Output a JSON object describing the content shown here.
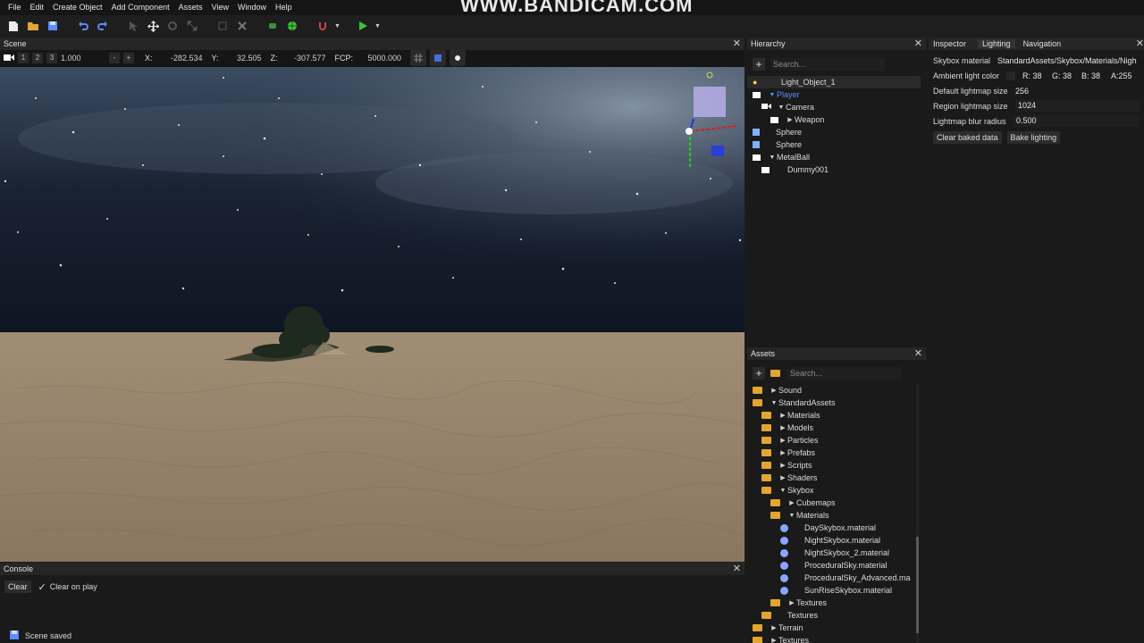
{
  "watermark": "WWW.BANDICAM.COM",
  "menubar": {
    "items": [
      "File",
      "Edit",
      "Create Object",
      "Add Component",
      "Assets",
      "View",
      "Window",
      "Help"
    ]
  },
  "scene": {
    "title": "Scene",
    "layers": [
      "1",
      "2",
      "3"
    ],
    "zoom": "1.000",
    "minus": "-",
    "plus": "+",
    "x_label": "X:",
    "x": "-282.534",
    "y_label": "Y:",
    "y": "32.505",
    "z_label": "Z:",
    "z": "-307.577",
    "fcp_label": "FCP:",
    "fcp": "5000.000"
  },
  "console": {
    "title": "Console",
    "clear": "Clear",
    "clear_on_play": "Clear on play",
    "status": "Scene saved"
  },
  "hierarchy": {
    "title": "Hierarchy",
    "search_placeholder": "Search...",
    "items": [
      {
        "label": "Light_Object_1"
      },
      {
        "label": "Player"
      },
      {
        "label": "Camera"
      },
      {
        "label": "Weapon"
      },
      {
        "label": "Sphere"
      },
      {
        "label": "Sphere"
      },
      {
        "label": "MetalBall"
      },
      {
        "label": "Dummy001"
      }
    ]
  },
  "assets": {
    "title": "Assets",
    "search_placeholder": "Search...",
    "items": [
      {
        "label": "Sound"
      },
      {
        "label": "StandardAssets"
      },
      {
        "label": "Materials"
      },
      {
        "label": "Models"
      },
      {
        "label": "Particles"
      },
      {
        "label": "Prefabs"
      },
      {
        "label": "Scripts"
      },
      {
        "label": "Shaders"
      },
      {
        "label": "Skybox"
      },
      {
        "label": "Cubemaps"
      },
      {
        "label": "Materials"
      },
      {
        "label": "DaySkybox.material"
      },
      {
        "label": "NightSkybox.material"
      },
      {
        "label": "NightSkybox_2.material"
      },
      {
        "label": "ProceduralSky.material"
      },
      {
        "label": "ProceduralSky_Advanced.ma"
      },
      {
        "label": "SunRiseSkybox.material"
      },
      {
        "label": "Textures"
      },
      {
        "label": "Textures"
      },
      {
        "label": "Terrain"
      },
      {
        "label": "Textures"
      }
    ]
  },
  "inspector": {
    "tabs": [
      "Inspector",
      "Lighting",
      "Navigation"
    ],
    "skybox_label": "Skybox material",
    "skybox_value": "StandardAssets/Skybox/Materials/Nigh",
    "ambient_label": "Ambient light color",
    "ambient_r": "R: 38",
    "ambient_g": "G: 38",
    "ambient_b": "B: 38",
    "ambient_a": "A:255",
    "lightmap_label": "Default lightmap size",
    "lightmap_value": "256",
    "region_label": "Region lightmap size",
    "region_value": "1024",
    "blur_label": "Lightmap blur radius",
    "blur_value": "0.500",
    "clear_baked": "Clear baked data",
    "bake": "Bake lighting"
  },
  "colors": {
    "accent_blue": "#5e8cff",
    "folder": "#e3a531",
    "play_green": "#3ec33e"
  }
}
